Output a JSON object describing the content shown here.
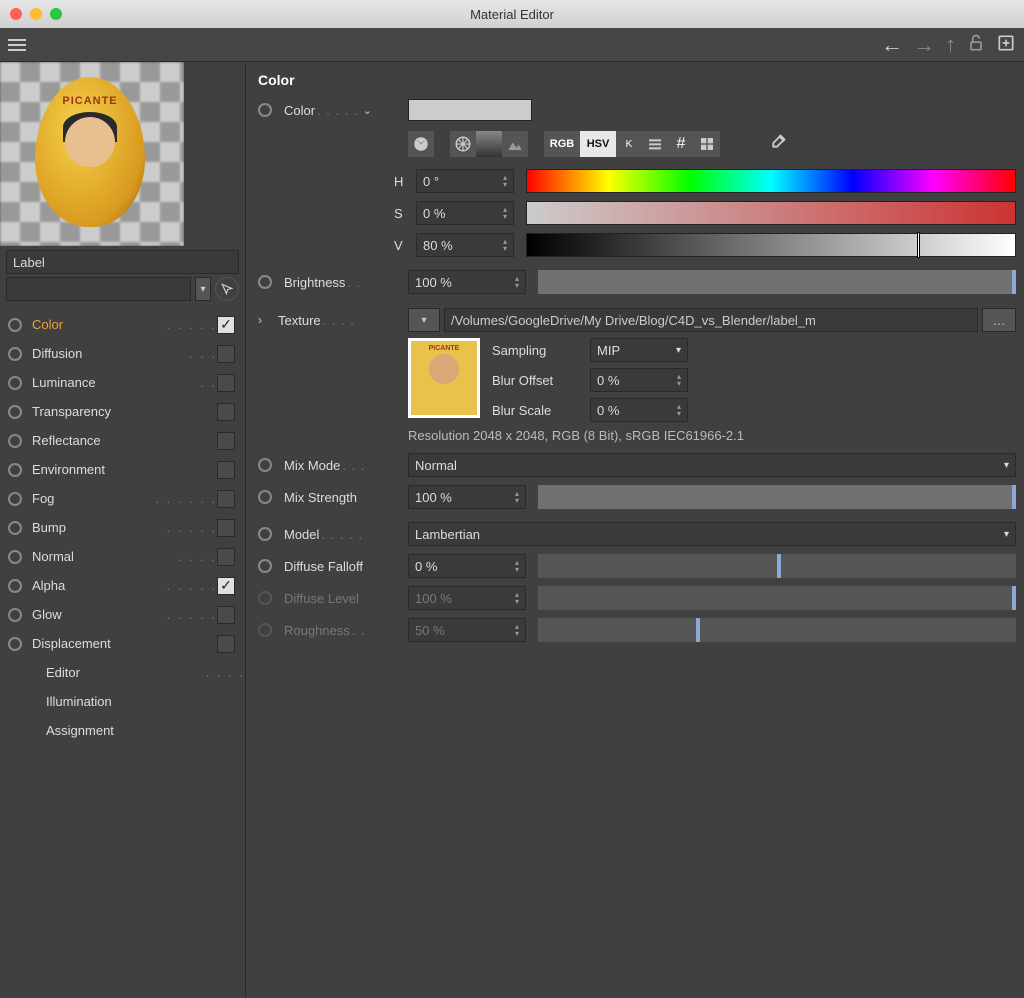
{
  "window": {
    "title": "Material Editor"
  },
  "sidebar": {
    "label_field": "Label",
    "channels": [
      {
        "label": "Color",
        "dots": ". . . . .",
        "active": true,
        "checked": true,
        "has_check": true,
        "has_radio": true
      },
      {
        "label": "Diffusion",
        "dots": ". . .",
        "active": false,
        "checked": false,
        "has_check": true,
        "has_radio": true
      },
      {
        "label": "Luminance",
        "dots": ". .",
        "active": false,
        "checked": false,
        "has_check": true,
        "has_radio": true
      },
      {
        "label": "Transparency",
        "dots": "",
        "active": false,
        "checked": false,
        "has_check": true,
        "has_radio": true
      },
      {
        "label": "Reflectance",
        "dots": "",
        "active": false,
        "checked": false,
        "has_check": true,
        "has_radio": true
      },
      {
        "label": "Environment",
        "dots": "",
        "active": false,
        "checked": false,
        "has_check": true,
        "has_radio": true
      },
      {
        "label": "Fog",
        "dots": ". . . . . .",
        "active": false,
        "checked": false,
        "has_check": true,
        "has_radio": true
      },
      {
        "label": "Bump",
        "dots": ". . . . .",
        "active": false,
        "checked": false,
        "has_check": true,
        "has_radio": true
      },
      {
        "label": "Normal",
        "dots": ". . . .",
        "active": false,
        "checked": false,
        "has_check": true,
        "has_radio": true
      },
      {
        "label": "Alpha",
        "dots": ". . . . .",
        "active": false,
        "checked": true,
        "has_check": true,
        "has_radio": true
      },
      {
        "label": "Glow",
        "dots": ". . . . .",
        "active": false,
        "checked": false,
        "has_check": true,
        "has_radio": true
      },
      {
        "label": "Displacement",
        "dots": "",
        "active": false,
        "checked": false,
        "has_check": true,
        "has_radio": true
      },
      {
        "label": "Editor",
        "dots": ". . . .",
        "active": false,
        "checked": false,
        "has_check": false,
        "has_radio": false
      },
      {
        "label": "Illumination",
        "dots": "",
        "active": false,
        "checked": false,
        "has_check": false,
        "has_radio": false
      },
      {
        "label": "Assignment",
        "dots": "",
        "active": false,
        "checked": false,
        "has_check": false,
        "has_radio": false
      }
    ]
  },
  "panel": {
    "title": "Color",
    "color_label": "Color",
    "color_dots": ". . . . .",
    "mode_buttons": {
      "rgb": "RGB",
      "hsv": "HSV",
      "k": "K"
    },
    "hsv": {
      "h_label": "H",
      "h_value": "0 °",
      "s_label": "S",
      "s_value": "0 %",
      "v_label": "V",
      "v_value": "80 %",
      "v_pos_pct": 80
    },
    "brightness": {
      "label": "Brightness",
      "dots": ". .",
      "value": "100 %",
      "pos_pct": 100
    },
    "texture": {
      "label": "Texture",
      "dots": ". . . .",
      "path": "/Volumes/GoogleDrive/My Drive/Blog/C4D_vs_Blender/label_m",
      "sampling_label": "Sampling",
      "sampling_value": "MIP",
      "blur_offset_label": "Blur Offset",
      "blur_offset_value": "0 %",
      "blur_scale_label": "Blur Scale",
      "blur_scale_value": "0 %",
      "resolution": "Resolution 2048 x 2048, RGB (8 Bit), sRGB IEC61966-2.1"
    },
    "mix_mode": {
      "label": "Mix Mode",
      "dots": ". . .",
      "value": "Normal"
    },
    "mix_strength": {
      "label": "Mix Strength",
      "value": "100 %",
      "pos_pct": 100
    },
    "model": {
      "label": "Model",
      "dots": ". . . . .",
      "value": "Lambertian"
    },
    "diffuse_falloff": {
      "label": "Diffuse Falloff",
      "value": "0 %",
      "pos_pct": 50
    },
    "diffuse_level": {
      "label": "Diffuse Level",
      "value": "100 %",
      "pos_pct": 100,
      "disabled": true
    },
    "roughness": {
      "label": "Roughness",
      "dots": ". .",
      "value": "50 %",
      "pos_pct": 33,
      "disabled": true
    }
  },
  "preview_egg_text": "PICANTE"
}
